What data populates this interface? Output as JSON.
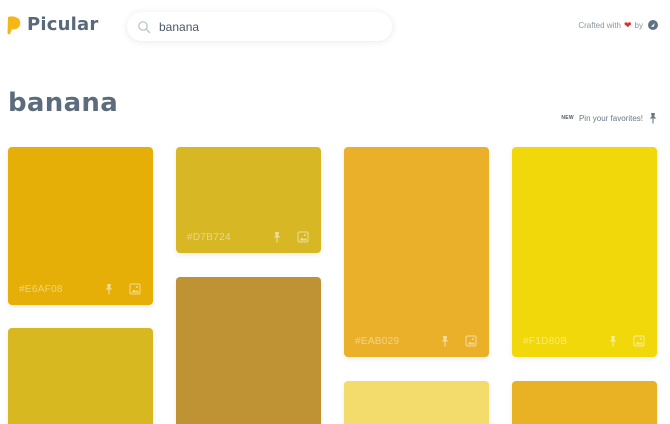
{
  "app": {
    "name": "Picular",
    "logo_color": "#f5b617"
  },
  "search": {
    "value": "banana",
    "placeholder": ""
  },
  "credit": {
    "prefix": "Crafted with",
    "heart": "❤",
    "suffix": "by"
  },
  "page": {
    "title": "banana"
  },
  "pin_hint": {
    "badge": "NEW",
    "text": "Pin your favorites!"
  },
  "swatches": [
    {
      "hex": "#E6AF08",
      "color": "#e6af08",
      "label": "#E6AF08"
    },
    {
      "hex": "#D7B724",
      "color": "#d7b724",
      "label": "#D7B724"
    },
    {
      "hex": "#EAB029",
      "color": "#eab029",
      "label": "#EAB029"
    },
    {
      "hex": "#F1D80B",
      "color": "#f1d80b",
      "label": "#F1D80B"
    },
    {
      "hex": "#D8B821",
      "color": "#d8b821",
      "label": ""
    },
    {
      "hex": "#BF9333",
      "color": "#bf9333",
      "label": ""
    },
    {
      "hex": "#F3DC6C",
      "color": "#f3dc6c",
      "label": ""
    },
    {
      "hex": "#E9B124",
      "color": "#e9b124",
      "label": ""
    }
  ]
}
